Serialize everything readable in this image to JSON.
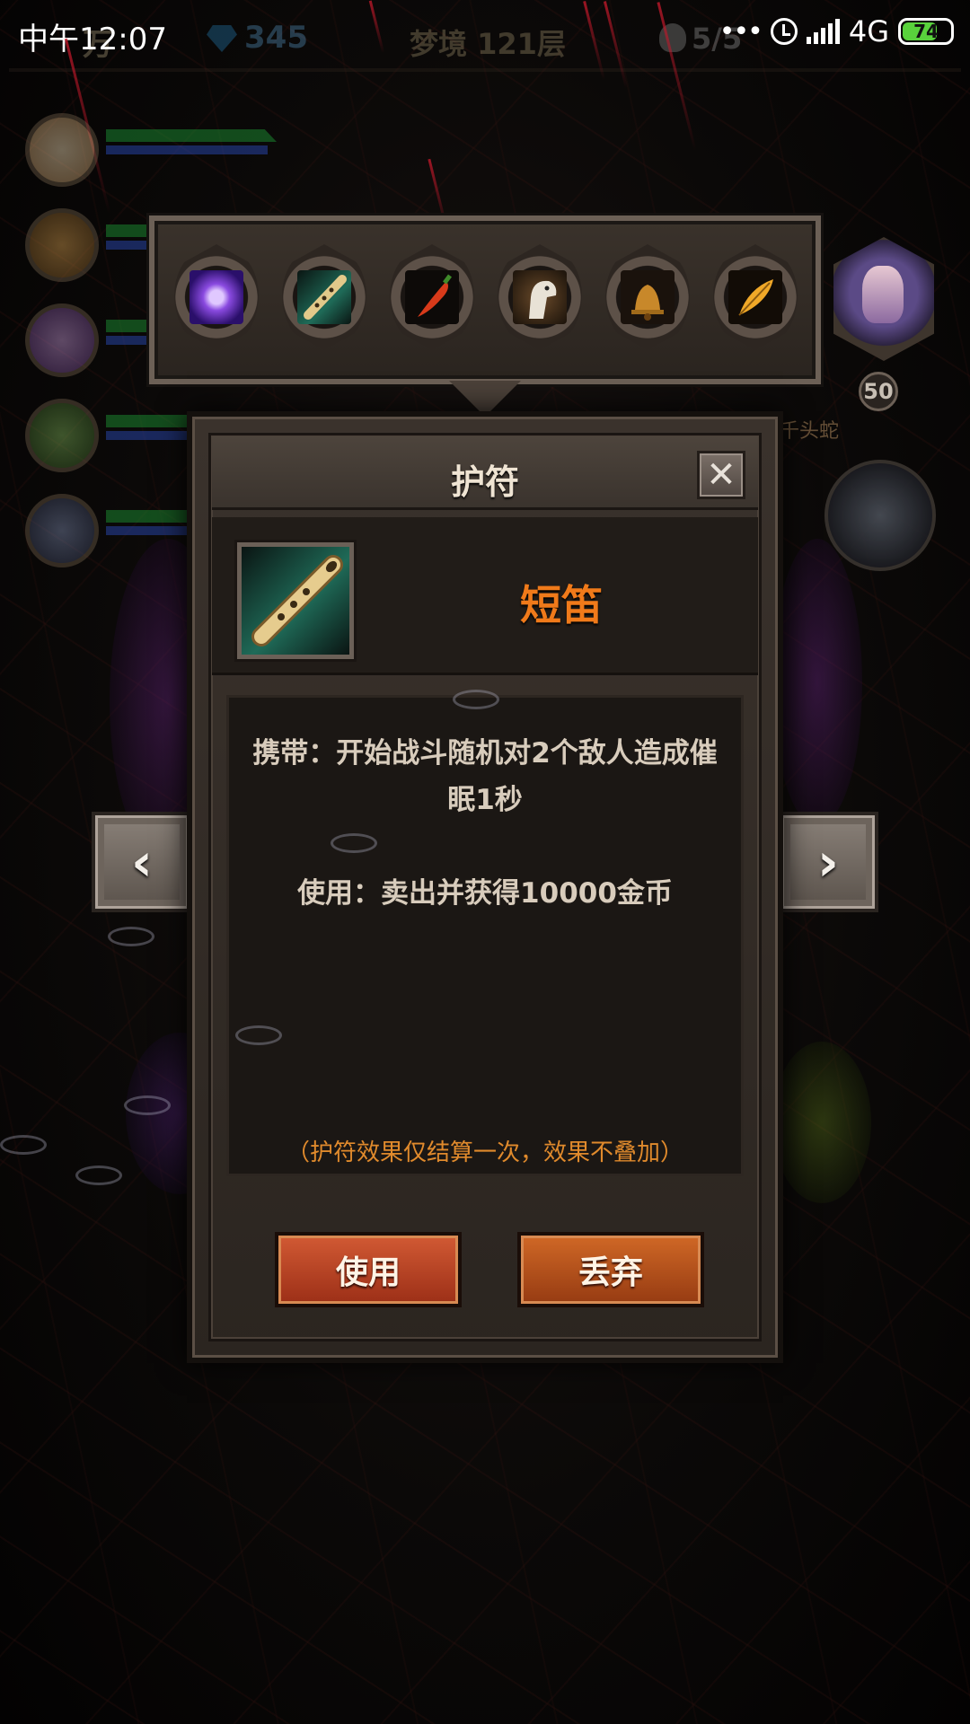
{
  "status_bar": {
    "time": "中午12:07",
    "network": "4G",
    "battery": "74",
    "battery_level": 0.74
  },
  "hud": {
    "gold": "万",
    "gems": "345",
    "floor": "梦境 121层",
    "kills": "5/5"
  },
  "amulet_slots": [
    {
      "icon": "purple-spirit-icon"
    },
    {
      "icon": "flute-icon"
    },
    {
      "icon": "chili-pepper-icon"
    },
    {
      "icon": "horse-head-icon"
    },
    {
      "icon": "bell-icon"
    },
    {
      "icon": "feather-icon"
    }
  ],
  "hero": {
    "level": "50",
    "name": "千头蛇"
  },
  "dialog": {
    "title": "护符",
    "close_label": "✕",
    "item_name": "短笛",
    "carry_text": "携带：开始战斗随机对2个敌人造成催眠1秒",
    "use_text": "使用：卖出并获得10000金币",
    "note": "（护符效果仅结算一次，效果不叠加）",
    "use_button": "使用",
    "drop_button": "丢弃"
  },
  "nav": {
    "prev": "‹",
    "next": "›"
  },
  "colors": {
    "item_name": "#f07a1a",
    "note": "#e08a2c",
    "use_button": "#c24a2a",
    "drop_button": "#c25a1e"
  }
}
